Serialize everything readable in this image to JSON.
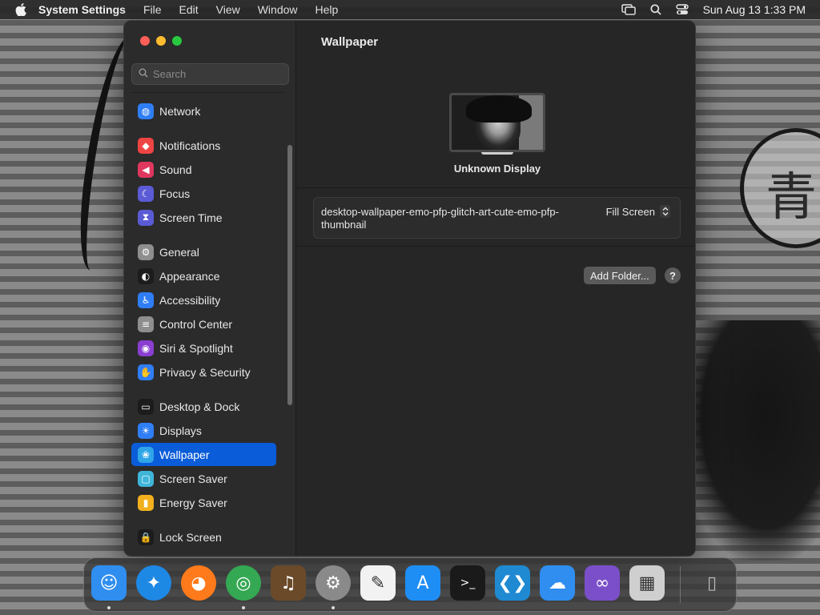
{
  "menubar": {
    "app_name": "System Settings",
    "menus": [
      "File",
      "Edit",
      "View",
      "Window",
      "Help"
    ],
    "datetime": "Sun Aug 13  1:33 PM"
  },
  "sidebar": {
    "search_placeholder": "Search",
    "items": [
      {
        "label": "Network",
        "icon": "globe-icon",
        "color": "#2f7ef5"
      },
      {
        "label": "Notifications",
        "icon": "bell-icon",
        "color": "#ef4444"
      },
      {
        "label": "Sound",
        "icon": "speaker-icon",
        "color": "#e0375f"
      },
      {
        "label": "Focus",
        "icon": "moon-icon",
        "color": "#5b5bd6"
      },
      {
        "label": "Screen Time",
        "icon": "hourglass-icon",
        "color": "#5b5bd6"
      },
      {
        "label": "General",
        "icon": "gear-icon",
        "color": "#8e8e8e"
      },
      {
        "label": "Appearance",
        "icon": "appearance-icon",
        "color": "#1c1c1c"
      },
      {
        "label": "Accessibility",
        "icon": "accessibility-icon",
        "color": "#2f7ef5"
      },
      {
        "label": "Control Center",
        "icon": "toggles-icon",
        "color": "#8e8e8e"
      },
      {
        "label": "Siri & Spotlight",
        "icon": "siri-icon",
        "color": "#8a3fd1"
      },
      {
        "label": "Privacy & Security",
        "icon": "hand-icon",
        "color": "#2f7ef5"
      },
      {
        "label": "Desktop & Dock",
        "icon": "dock-icon",
        "color": "#1c1c1c"
      },
      {
        "label": "Displays",
        "icon": "sun-icon",
        "color": "#2f7ef5"
      },
      {
        "label": "Wallpaper",
        "icon": "flower-icon",
        "color": "#2fa5e8"
      },
      {
        "label": "Screen Saver",
        "icon": "screensaver-icon",
        "color": "#3fb6d9"
      },
      {
        "label": "Energy Saver",
        "icon": "battery-icon",
        "color": "#f2b01e"
      },
      {
        "label": "Lock Screen",
        "icon": "lock-icon",
        "color": "#1c1c1c"
      }
    ],
    "selected": "Wallpaper"
  },
  "main": {
    "title": "Wallpaper",
    "display_name": "Unknown Display",
    "wallpaper_name": "desktop-wallpaper-emo-pfp-glitch-art-cute-emo-pfp-thumbnail",
    "fill_mode": "Fill Screen",
    "add_folder_label": "Add Folder...",
    "help_label": "?"
  },
  "dock": {
    "apps": [
      {
        "name": "finder-icon",
        "color": "#2f8ef0",
        "running": true
      },
      {
        "name": "safari-icon",
        "color": "#1e88e5",
        "running": false
      },
      {
        "name": "firefox-icon",
        "color": "#ff7a1a",
        "running": false
      },
      {
        "name": "chrome-icon",
        "color": "#34a853",
        "running": true
      },
      {
        "name": "garageband-icon",
        "color": "#6b4a2a",
        "running": false
      },
      {
        "name": "system-settings-icon",
        "color": "#8a8a8a",
        "running": true
      },
      {
        "name": "textedit-icon",
        "color": "#f2f2f2",
        "running": false
      },
      {
        "name": "app-store-icon",
        "color": "#1e8ef5",
        "running": false
      },
      {
        "name": "terminal-icon",
        "color": "#1a1a1a",
        "running": false
      },
      {
        "name": "vscode-icon",
        "color": "#1f8ad2",
        "running": false
      },
      {
        "name": "weather-icon",
        "color": "#2f8ef0",
        "running": false
      },
      {
        "name": "visual-studio-icon",
        "color": "#7b4fc9",
        "running": false
      },
      {
        "name": "launchpad-icon",
        "color": "#cfcfcf",
        "running": false
      },
      {
        "name": "trash-icon",
        "color": "#9a9a9a",
        "running": false
      }
    ]
  }
}
